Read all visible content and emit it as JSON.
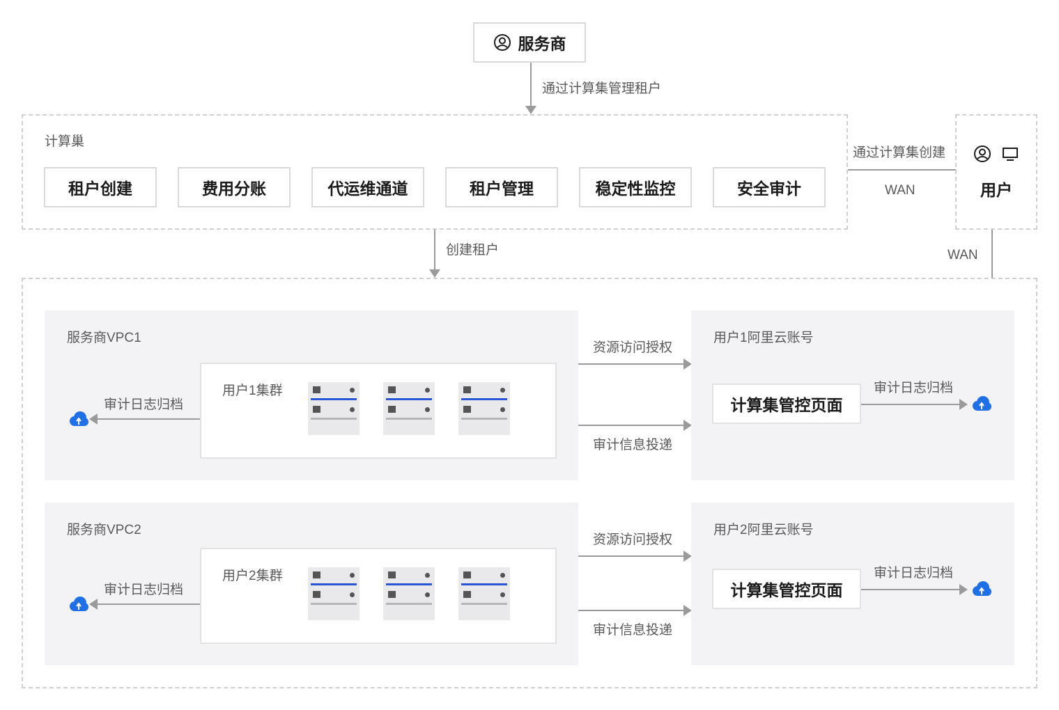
{
  "provider": {
    "label": "服务商",
    "icon": "user-circle-icon"
  },
  "arrows": {
    "manage_tenants": "通过计算集管理租户",
    "create_tenant": "创建租户",
    "create_via_compute_nest": "通过计算集创建",
    "wan_horizontal": "WAN",
    "wan_vertical": "WAN"
  },
  "compute_nest": {
    "title": "计算巢",
    "features": [
      "租户创建",
      "费用分账",
      "代运维通道",
      "租户管理",
      "稳定性监控",
      "安全审计"
    ]
  },
  "user": {
    "label": "用户",
    "icons": [
      "user-circle-icon",
      "monitor-icon"
    ]
  },
  "rows": [
    {
      "vpc_label": "服务商VPC1",
      "cluster_label": "用户1集群",
      "audit_archive_left": "审计日志归档",
      "resource_auth": "资源访问授权",
      "audit_delivery": "审计信息投递",
      "account_label": "用户1阿里云账号",
      "console_label": "计算集管控页面",
      "audit_archive_right": "审计日志归档"
    },
    {
      "vpc_label": "服务商VPC2",
      "cluster_label": "用户2集群",
      "audit_archive_left": "审计日志归档",
      "resource_auth": "资源访问授权",
      "audit_delivery": "审计信息投递",
      "account_label": "用户2阿里云账号",
      "console_label": "计算集管控页面",
      "audit_archive_right": "审计日志归档"
    }
  ],
  "colors": {
    "accent_blue": "#2a55d4",
    "cloud_blue": "#1f6fe6",
    "line_gray": "#9a9a9a",
    "panel_gray": "#f3f3f5"
  }
}
